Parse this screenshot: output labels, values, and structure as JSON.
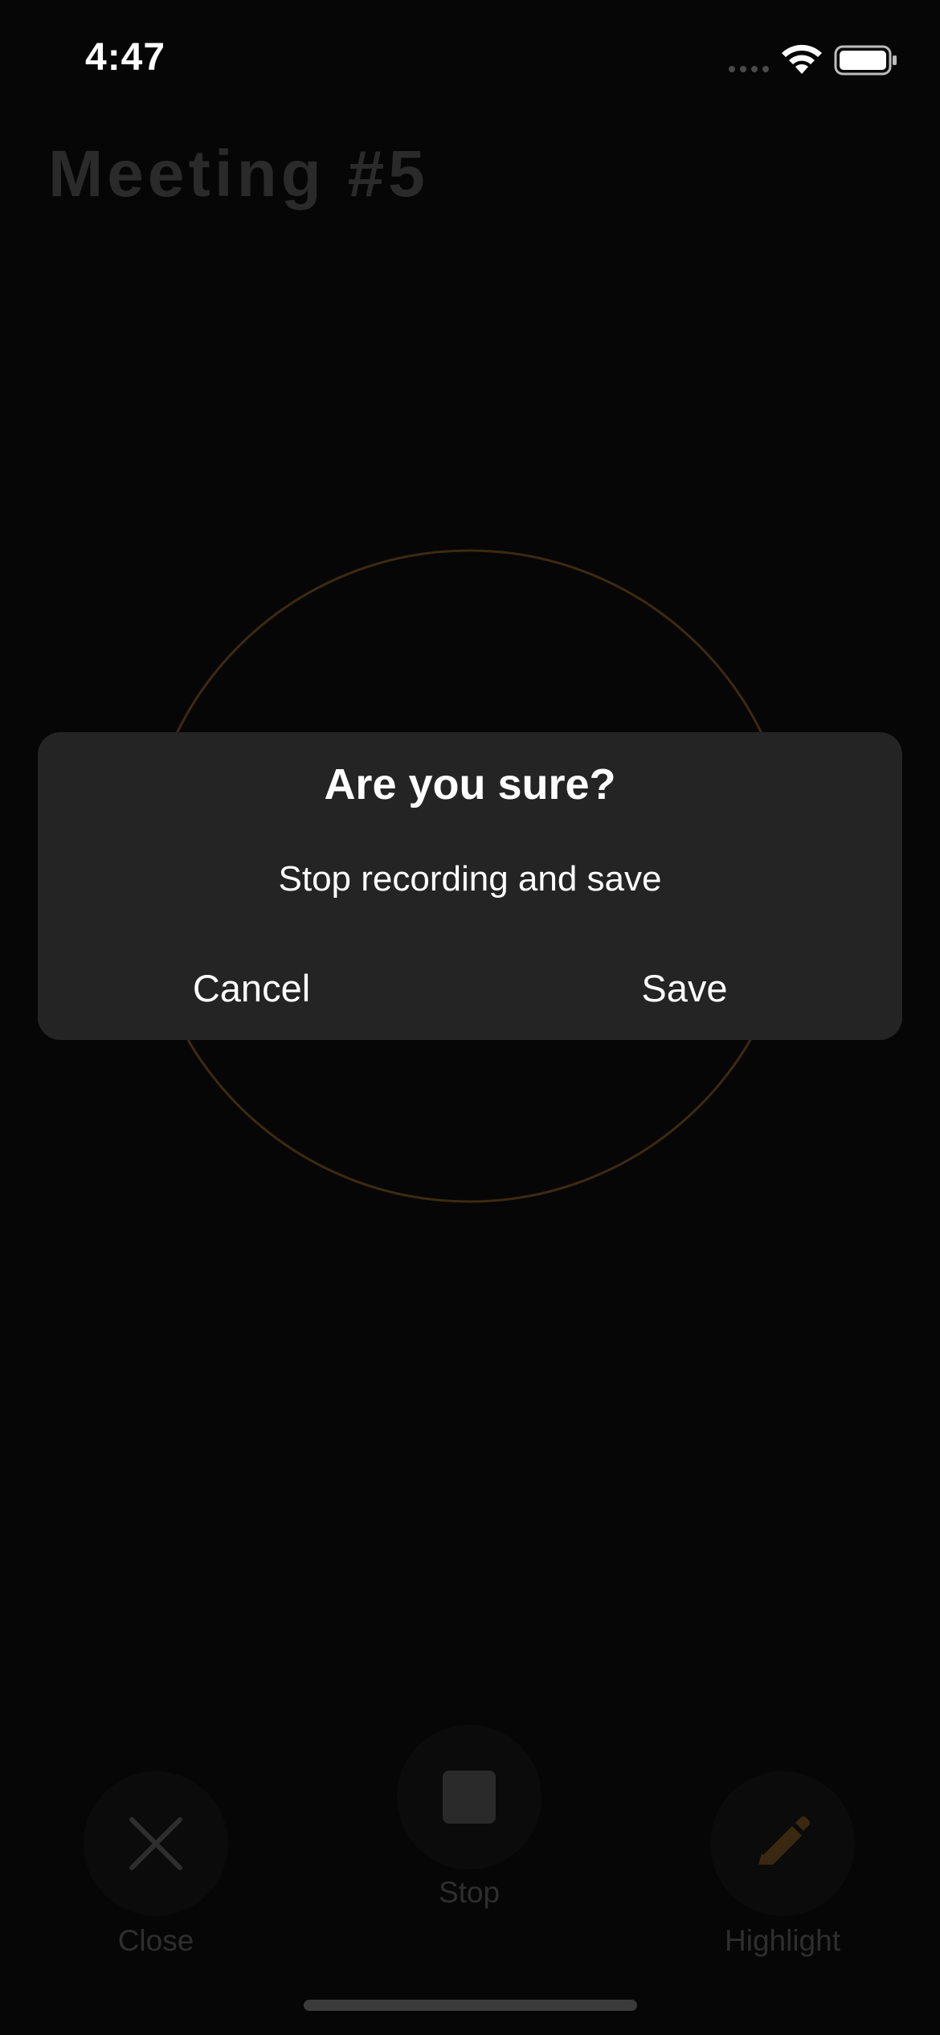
{
  "status_bar": {
    "time": "4:47",
    "icons": [
      "signal-icon",
      "wifi-icon",
      "battery-icon"
    ]
  },
  "page": {
    "title": "Meeting #5"
  },
  "dialog": {
    "title": "Are you sure?",
    "message": "Stop recording and save",
    "cancel_label": "Cancel",
    "save_label": "Save"
  },
  "controls": {
    "close": {
      "label": "Close",
      "icon": "close-icon"
    },
    "stop": {
      "label": "Stop",
      "icon": "stop-icon"
    },
    "highlight": {
      "label": "Highlight",
      "icon": "pencil-icon"
    }
  },
  "colors": {
    "background": "#060606",
    "dialog_background": "#242424",
    "ring_accent": "#3d2a10",
    "highlight_accent": "#3a2810",
    "dimmed_text": "#2e2e2e"
  }
}
